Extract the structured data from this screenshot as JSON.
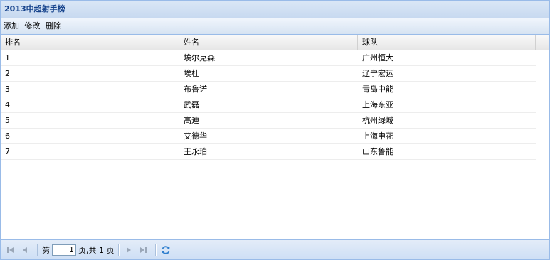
{
  "panel": {
    "title": "2013中超射手榜"
  },
  "toolbar": {
    "add": "添加",
    "edit": "修改",
    "delete": "删除"
  },
  "grid": {
    "columns": [
      "排名",
      "姓名",
      "球队"
    ],
    "rows": [
      [
        "1",
        "埃尔克森",
        "广州恒大"
      ],
      [
        "2",
        "埃杜",
        "辽宁宏运"
      ],
      [
        "3",
        "布鲁诺",
        "青岛中能"
      ],
      [
        "4",
        "武磊",
        "上海东亚"
      ],
      [
        "5",
        "高迪",
        "杭州绿城"
      ],
      [
        "6",
        "艾德华",
        "上海申花"
      ],
      [
        "7",
        "王永珀",
        "山东鲁能"
      ]
    ]
  },
  "pager": {
    "page_prefix": "第",
    "current_page": "1",
    "page_suffix": "页,共 1 页"
  }
}
